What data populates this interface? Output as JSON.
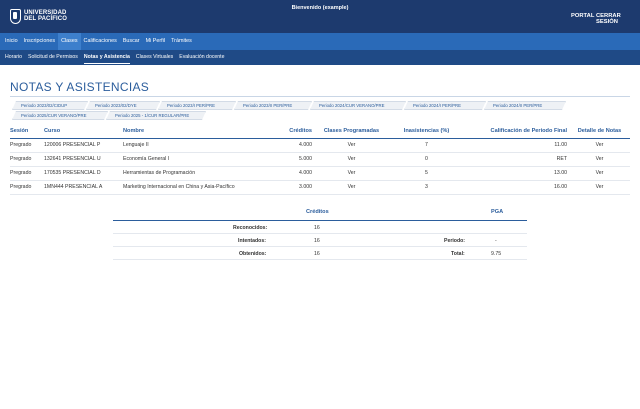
{
  "header": {
    "logo_line1": "UNIVERSIDAD",
    "logo_line2": "DEL PACÍFICO",
    "welcome": "Bienvenido (example)",
    "portal": "PORTAL",
    "logout": "CERRAR SESIÓN"
  },
  "menu": {
    "items": [
      "Inicio",
      "Inscripciones",
      "Clases",
      "Calificaciones",
      "Buscar",
      "Mi Perfil",
      "Trámites"
    ],
    "active": "Clases"
  },
  "submenu": {
    "items": [
      "Horario",
      "Solicitud de Permisos",
      "Notas y Asistencia",
      "Clases Virtuales",
      "Evaluación docente"
    ],
    "active": "Notas y Asistencia"
  },
  "page": {
    "title": "NOTAS Y ASISTENCIAS"
  },
  "periods": [
    "Periodo 2023/02/CIDUP",
    "Periodo 2023/02/DYE",
    "Periodo 2023/I PER/PRE",
    "Periodo 2023/II PER/PRE",
    "Periodo 2024/CUR VERANO/PRE",
    "Periodo 2024/I PER/PRE",
    "Periodo 2024/II PER/PRE",
    "Periodo 2025/CUR VERANO/PRE",
    "Periodo 2025 - 1/CUR REGULAR/PRE"
  ],
  "grades": {
    "headers": {
      "sesion": "Sesión",
      "curso": "Curso",
      "nombre": "Nombre",
      "creditos": "Créditos",
      "clases": "Clases Programadas",
      "inasistencias": "Inasistencias (%)",
      "calificacion": "Calificación de Periodo Final",
      "detalle": "Detalle de Notas"
    },
    "rows": [
      {
        "sesion": "Pregrado",
        "curso": "120006 PRESENCIAL P",
        "nombre": "Lenguaje II",
        "creditos": "4.000",
        "clases": "Ver",
        "inasistencias": "7",
        "calificacion": "11.00",
        "detalle": "Ver"
      },
      {
        "sesion": "Pregrado",
        "curso": "132641 PRESENCIAL U",
        "nombre": "Economía General I",
        "creditos": "5.000",
        "clases": "Ver",
        "inasistencias": "0",
        "calificacion": "RET",
        "detalle": "Ver"
      },
      {
        "sesion": "Pregrado",
        "curso": "170535 PRESENCIAL D",
        "nombre": "Herramientas de Programación",
        "creditos": "4.000",
        "clases": "Ver",
        "inasistencias": "5",
        "calificacion": "13.00",
        "detalle": "Ver"
      },
      {
        "sesion": "Pregrado",
        "curso": "1MN444 PRESENCIAL A",
        "nombre": "Marketing Internacional en China y Asia-Pacífico",
        "creditos": "3.000",
        "clases": "Ver",
        "inasistencias": "3",
        "calificacion": "16.00",
        "detalle": "Ver"
      }
    ]
  },
  "summary": {
    "creditos_header": "Créditos",
    "pga_header": "PGA",
    "reconocidos_label": "Reconocidos:",
    "reconocidos_value": "16",
    "intentados_label": "Intentados:",
    "intentados_value": "16",
    "obtenidos_label": "Obtenidos:",
    "obtenidos_value": "16",
    "periodo_label": "Periodo:",
    "periodo_value": "-",
    "total_label": "Total:",
    "total_value": "9.75"
  }
}
